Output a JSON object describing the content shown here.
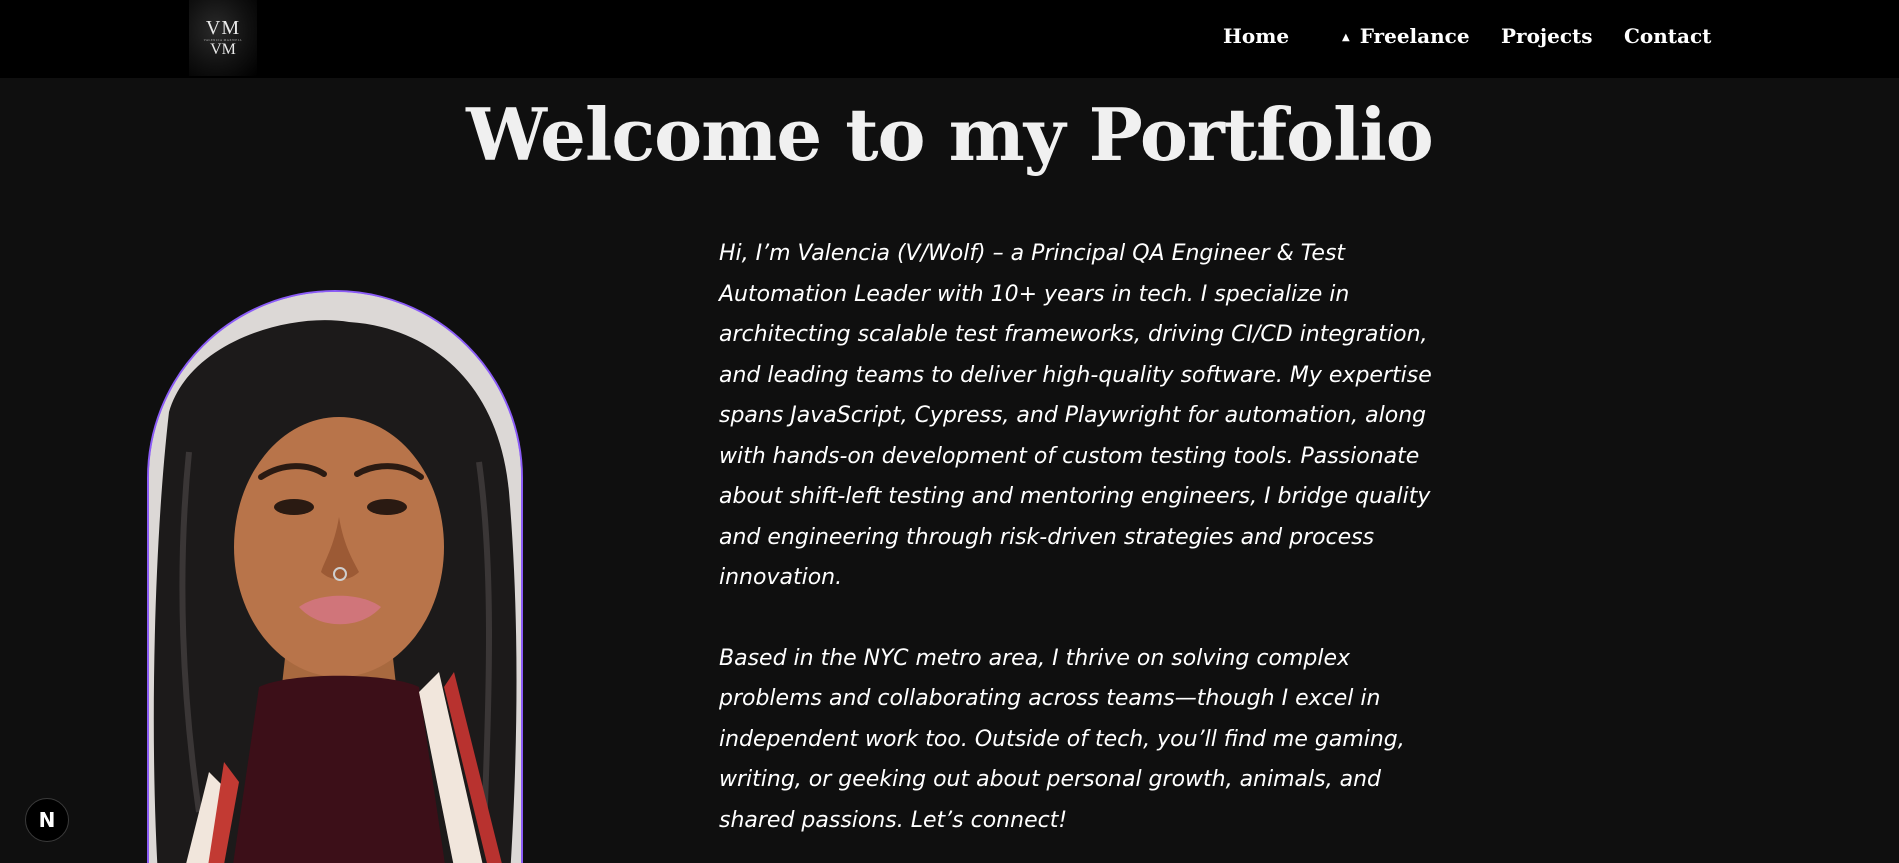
{
  "header": {
    "logo": {
      "monogram_top": "VM",
      "monogram_sub": "VALENCIA MAXWELL",
      "monogram_bottom": "VM"
    },
    "nav": [
      {
        "label": "Home"
      },
      {
        "label": "Freelance",
        "icon": "caret-up-icon"
      },
      {
        "label": "Projects"
      },
      {
        "label": "Contact"
      }
    ]
  },
  "main": {
    "title": "Welcome to my Portfolio",
    "bio": [
      "Hi, I’m Valencia (V/Wolf) – a Principal QA Engineer & Test Automation Leader with 10+ years in tech. I specialize in architecting scalable test frameworks, driving CI/CD integration, and leading teams to deliver high-quality software. My expertise spans JavaScript, Cypress, and Playwright for automation, along with hands-on development of custom testing tools. Passionate about shift-left testing and mentoring engineers, I bridge quality and engineering through risk-driven strategies and process innovation.",
      "Based in the NYC metro area, I thrive on solving complex problems and collaborating across teams—though I excel in independent work too. Outside of tech, you’ll find me gaming, writing, or geeking out about personal growth, animals, and shared passions. Let’s connect!"
    ]
  },
  "badge": {
    "label": "N"
  },
  "colors": {
    "background": "#0f0f0f",
    "header": "#000000",
    "portrait_border": "#8b5cf6",
    "text": "#ffffff"
  }
}
